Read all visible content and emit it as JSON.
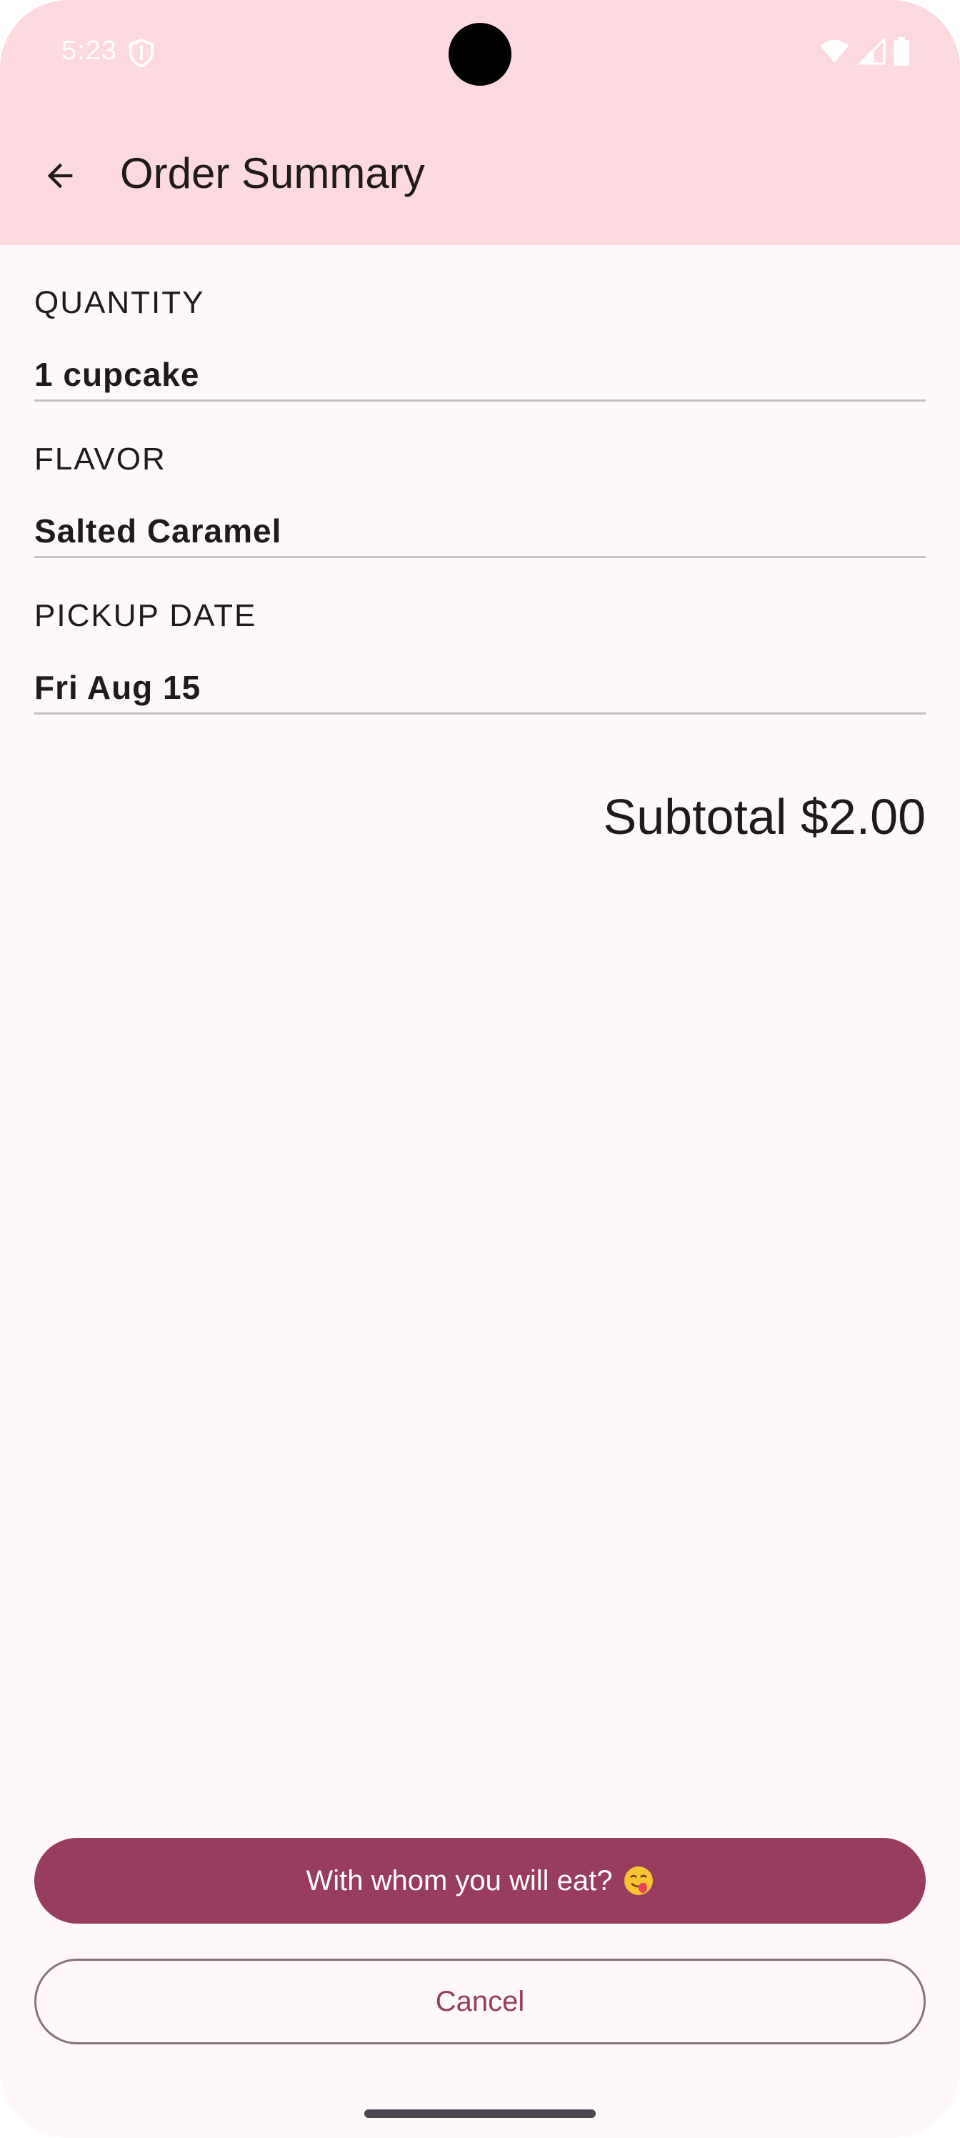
{
  "status_bar": {
    "time": "5:23",
    "icons": [
      "vpn-shield-icon",
      "wifi-icon",
      "cell-signal-icon",
      "battery-icon"
    ]
  },
  "app_bar": {
    "back_icon": "arrow-back-icon",
    "title": "Order Summary"
  },
  "summary": {
    "sections": [
      {
        "label": "QUANTITY",
        "value": "1 cupcake"
      },
      {
        "label": "FLAVOR",
        "value": "Salted Caramel"
      },
      {
        "label": "PICKUP DATE",
        "value": "Fri Aug 15"
      }
    ],
    "subtotal": "Subtotal $2.00"
  },
  "actions": {
    "primary_label": "With whom you will eat?",
    "primary_icon": "face-savoring-food-emoji-icon",
    "cancel_label": "Cancel"
  },
  "colors": {
    "app_bar_bg": "#fdd9e0",
    "page_bg": "#fff8fb",
    "primary": "#983d60",
    "text": "#201a1b",
    "divider": "#c7bfc1"
  }
}
